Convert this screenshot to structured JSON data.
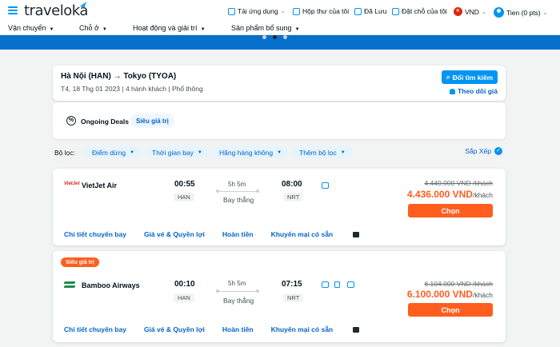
{
  "header": {
    "logo": "traveloka",
    "links": [
      {
        "label": "Tải ứng dụng",
        "icon": "phone-icon"
      },
      {
        "label": "Hộp thư của tôi",
        "icon": "inbox-icon"
      },
      {
        "label": "Đã Lưu",
        "icon": "bookmark-icon"
      },
      {
        "label": "Đặt chỗ của tôi",
        "icon": "booking-icon"
      }
    ],
    "currency": "VND",
    "user": "Tien (0 pts)"
  },
  "nav": {
    "items": [
      "Vận chuyển",
      "Chỗ ở",
      "Hoạt động và giải trí",
      "Sản phẩm bổ sung"
    ]
  },
  "search": {
    "route": "Hà Nội (HAN) → Tokyo (TYOA)",
    "details": "T4, 18 Thg 01 2023  |  4 hành khách  |  Phổ thông",
    "change_button": "Đổi tìm kiếm",
    "follow_price": "Theo dõi giá"
  },
  "deals": {
    "label": "Ongoing Deals",
    "chip": "Siêu giá trị"
  },
  "filters": {
    "label": "Bộ lọc:",
    "chips": [
      "Điểm dừng",
      "Thời gian bay",
      "Hãng hàng không",
      "Thêm bộ lọc"
    ],
    "sort": "Sắp Xếp"
  },
  "flights": [
    {
      "airline": "VietJet Air",
      "logo_text": "VietJet",
      "dep_time": "00:55",
      "dep_code": "HAN",
      "duration": "5h 5m",
      "stops": "Bay thẳng",
      "arr_time": "08:00",
      "arr_code": "NRT",
      "old_price": "4.440.000 VND /khách",
      "price": "4.436.000 VND",
      "price_unit": "/khách",
      "choose": "Chọn",
      "tabs": [
        "Chi tiết chuyến bay",
        "Giá vé & Quyền lợi",
        "Hoàn tiền",
        "Khuyến mại có sẵn"
      ]
    },
    {
      "badge": "Siêu giá trị",
      "airline": "Bamboo Airways",
      "dep_time": "00:10",
      "dep_code": "HAN",
      "duration": "5h 5m",
      "stops": "Bay thẳng",
      "arr_time": "07:15",
      "arr_code": "NRT",
      "old_price": "6.104.000 VND /khách",
      "price": "6.100.000 VND",
      "price_unit": "/khách",
      "choose": "Chọn",
      "tabs": [
        "Chi tiết chuyến bay",
        "Giá vé & Quyền lợi",
        "Hoàn tiền",
        "Khuyến mại có sẵn"
      ]
    }
  ]
}
